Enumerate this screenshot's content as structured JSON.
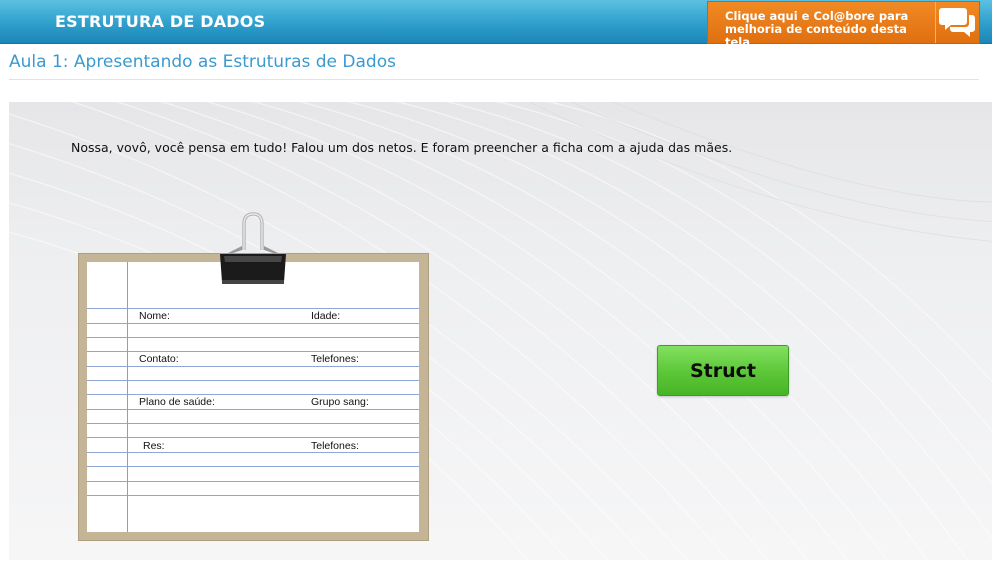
{
  "header": {
    "course_title": "ESTRUTURA DE DADOS",
    "collab_line1": "Clique aqui e Col@bore para",
    "collab_line2": "melhoria de conteúdo desta tela"
  },
  "lesson": {
    "title": "Aula 1: Apresentando as Estruturas de Dados"
  },
  "content": {
    "narration": "Nossa, vovô, você pensa em tudo! Falou um dos netos.  E foram preencher a ficha com a ajuda das mães.",
    "form": {
      "nome": "Nome:",
      "idade": "Idade:",
      "contato": "Contato:",
      "telefones1": "Telefones:",
      "plano": "Plano de saúde:",
      "grupo": "Grupo sang:",
      "res": "Res:",
      "telefones2": "Telefones:"
    },
    "struct_button": "Struct"
  },
  "colors": {
    "header_blue": "#2f9fcc",
    "collab_orange": "#e97d1a",
    "lesson_title_blue": "#3a9ad0",
    "button_green": "#5ec83a",
    "form_line_blue": "#8fa7d8",
    "margin_red": "#e87b7b"
  },
  "icons": {
    "collab": "speech-bubbles-icon",
    "clip": "binder-clip-icon"
  }
}
